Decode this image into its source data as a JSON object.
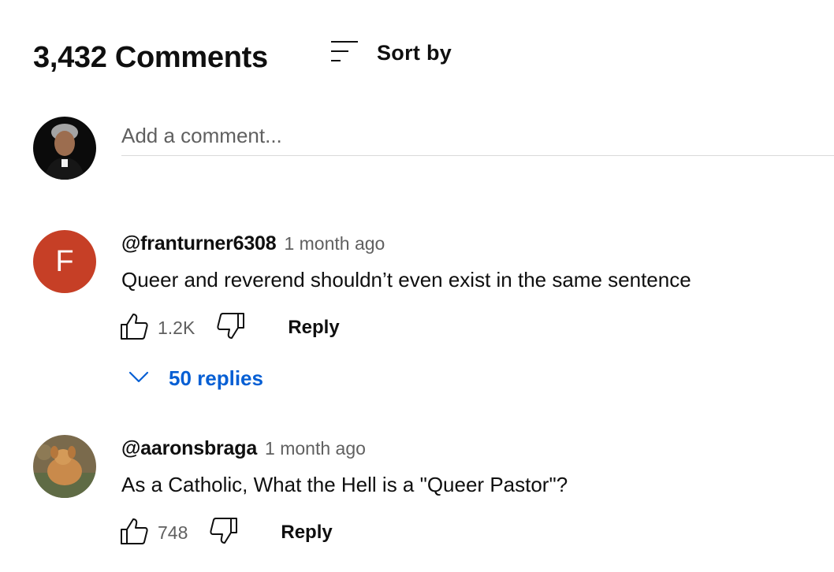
{
  "comments_header": {
    "count_label": "3,432 Comments",
    "sort_label": "Sort by",
    "sort_icon": "sort-icon"
  },
  "composer": {
    "placeholder": "Add a comment..."
  },
  "comments": [
    {
      "avatar_letter": "F",
      "author": "@franturner6308",
      "time": "1 month ago",
      "text": "Queer and reverend shouldn’t even exist in the same sentence",
      "likes": "1.2K",
      "reply_label": "Reply",
      "replies_label": "50 replies"
    },
    {
      "author": "@aaronsbraga",
      "time": "1 month ago",
      "text": "As a Catholic, What the Hell is a \"Queer Pastor\"?",
      "likes": "748",
      "reply_label": "Reply"
    }
  ],
  "colors": {
    "accent_link": "#065fd4",
    "avatar_f_bg": "#c63f26",
    "secondary_text": "#606060"
  }
}
